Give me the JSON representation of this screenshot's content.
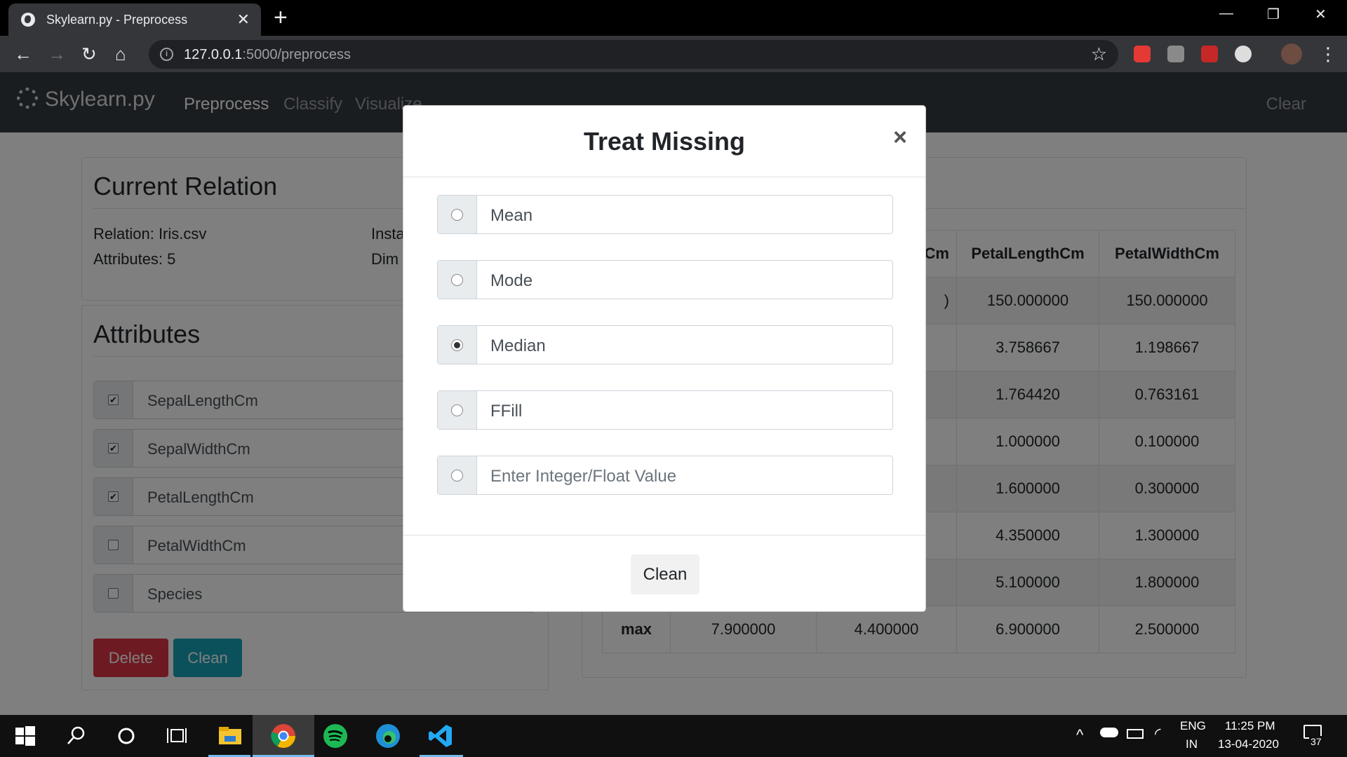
{
  "browser": {
    "tab_title": "Skylearn.py - Preprocess",
    "tab_close": "✕",
    "new_tab": "+",
    "url_host": "127.0.0.1",
    "url_path": ":5000/preprocess",
    "win_min": "—",
    "win_restore": "❐",
    "win_close": "✕"
  },
  "app": {
    "brand": "Skylearn.py",
    "nav": [
      "Preprocess",
      "Classify",
      "Visualize"
    ],
    "nav_clear": "Clear"
  },
  "relation": {
    "title": "Current Relation",
    "relation": "Relation: Iris.csv",
    "attributes": "Attributes: 5",
    "instances": "Insta",
    "dimensions": "Dim"
  },
  "attributes": {
    "title": "Attributes",
    "items": [
      {
        "name": "SepalLengthCm",
        "checked": true
      },
      {
        "name": "SepalWidthCm",
        "checked": true
      },
      {
        "name": "PetalLengthCm",
        "checked": true
      },
      {
        "name": "PetalWidthCm",
        "checked": false
      },
      {
        "name": "Species",
        "checked": false
      }
    ],
    "delete_label": "Delete",
    "clean_label": "Clean"
  },
  "stats_table": {
    "headers": [
      "Cm",
      "PetalLengthCm",
      "PetalWidthCm"
    ],
    "rows": [
      {
        "label": "",
        "c1": "",
        "c2": ")",
        "c3": "150.000000",
        "c4": "150.000000"
      },
      {
        "label": "",
        "c1": "",
        "c2": "",
        "c3": "3.758667",
        "c4": "1.198667"
      },
      {
        "label": "",
        "c1": "",
        "c2": "",
        "c3": "1.764420",
        "c4": "0.763161"
      },
      {
        "label": "",
        "c1": "",
        "c2": "",
        "c3": "1.000000",
        "c4": "0.100000"
      },
      {
        "label": "",
        "c1": "",
        "c2": "",
        "c3": "1.600000",
        "c4": "0.300000"
      },
      {
        "label": "",
        "c1": "",
        "c2": "",
        "c3": "4.350000",
        "c4": "1.300000"
      },
      {
        "label": "",
        "c1": "",
        "c2": "",
        "c3": "5.100000",
        "c4": "1.800000"
      },
      {
        "label": "max",
        "c1": "7.900000",
        "c2": "4.400000",
        "c3": "6.900000",
        "c4": "2.500000"
      }
    ]
  },
  "modal": {
    "title": "Treat Missing",
    "close": "×",
    "options": [
      {
        "label": "Mean",
        "checked": false
      },
      {
        "label": "Mode",
        "checked": false
      },
      {
        "label": "Median",
        "checked": true
      },
      {
        "label": "FFill",
        "checked": false
      }
    ],
    "value_placeholder": "Enter Integer/Float Value",
    "clean_label": "Clean"
  },
  "taskbar": {
    "lang": "ENG",
    "region": "IN",
    "time": "11:25 PM",
    "date": "13-04-2020",
    "notifications": "37"
  },
  "colors": {
    "danger": "#dc3545",
    "info": "#17a2b8",
    "navbar": "#343a40"
  }
}
